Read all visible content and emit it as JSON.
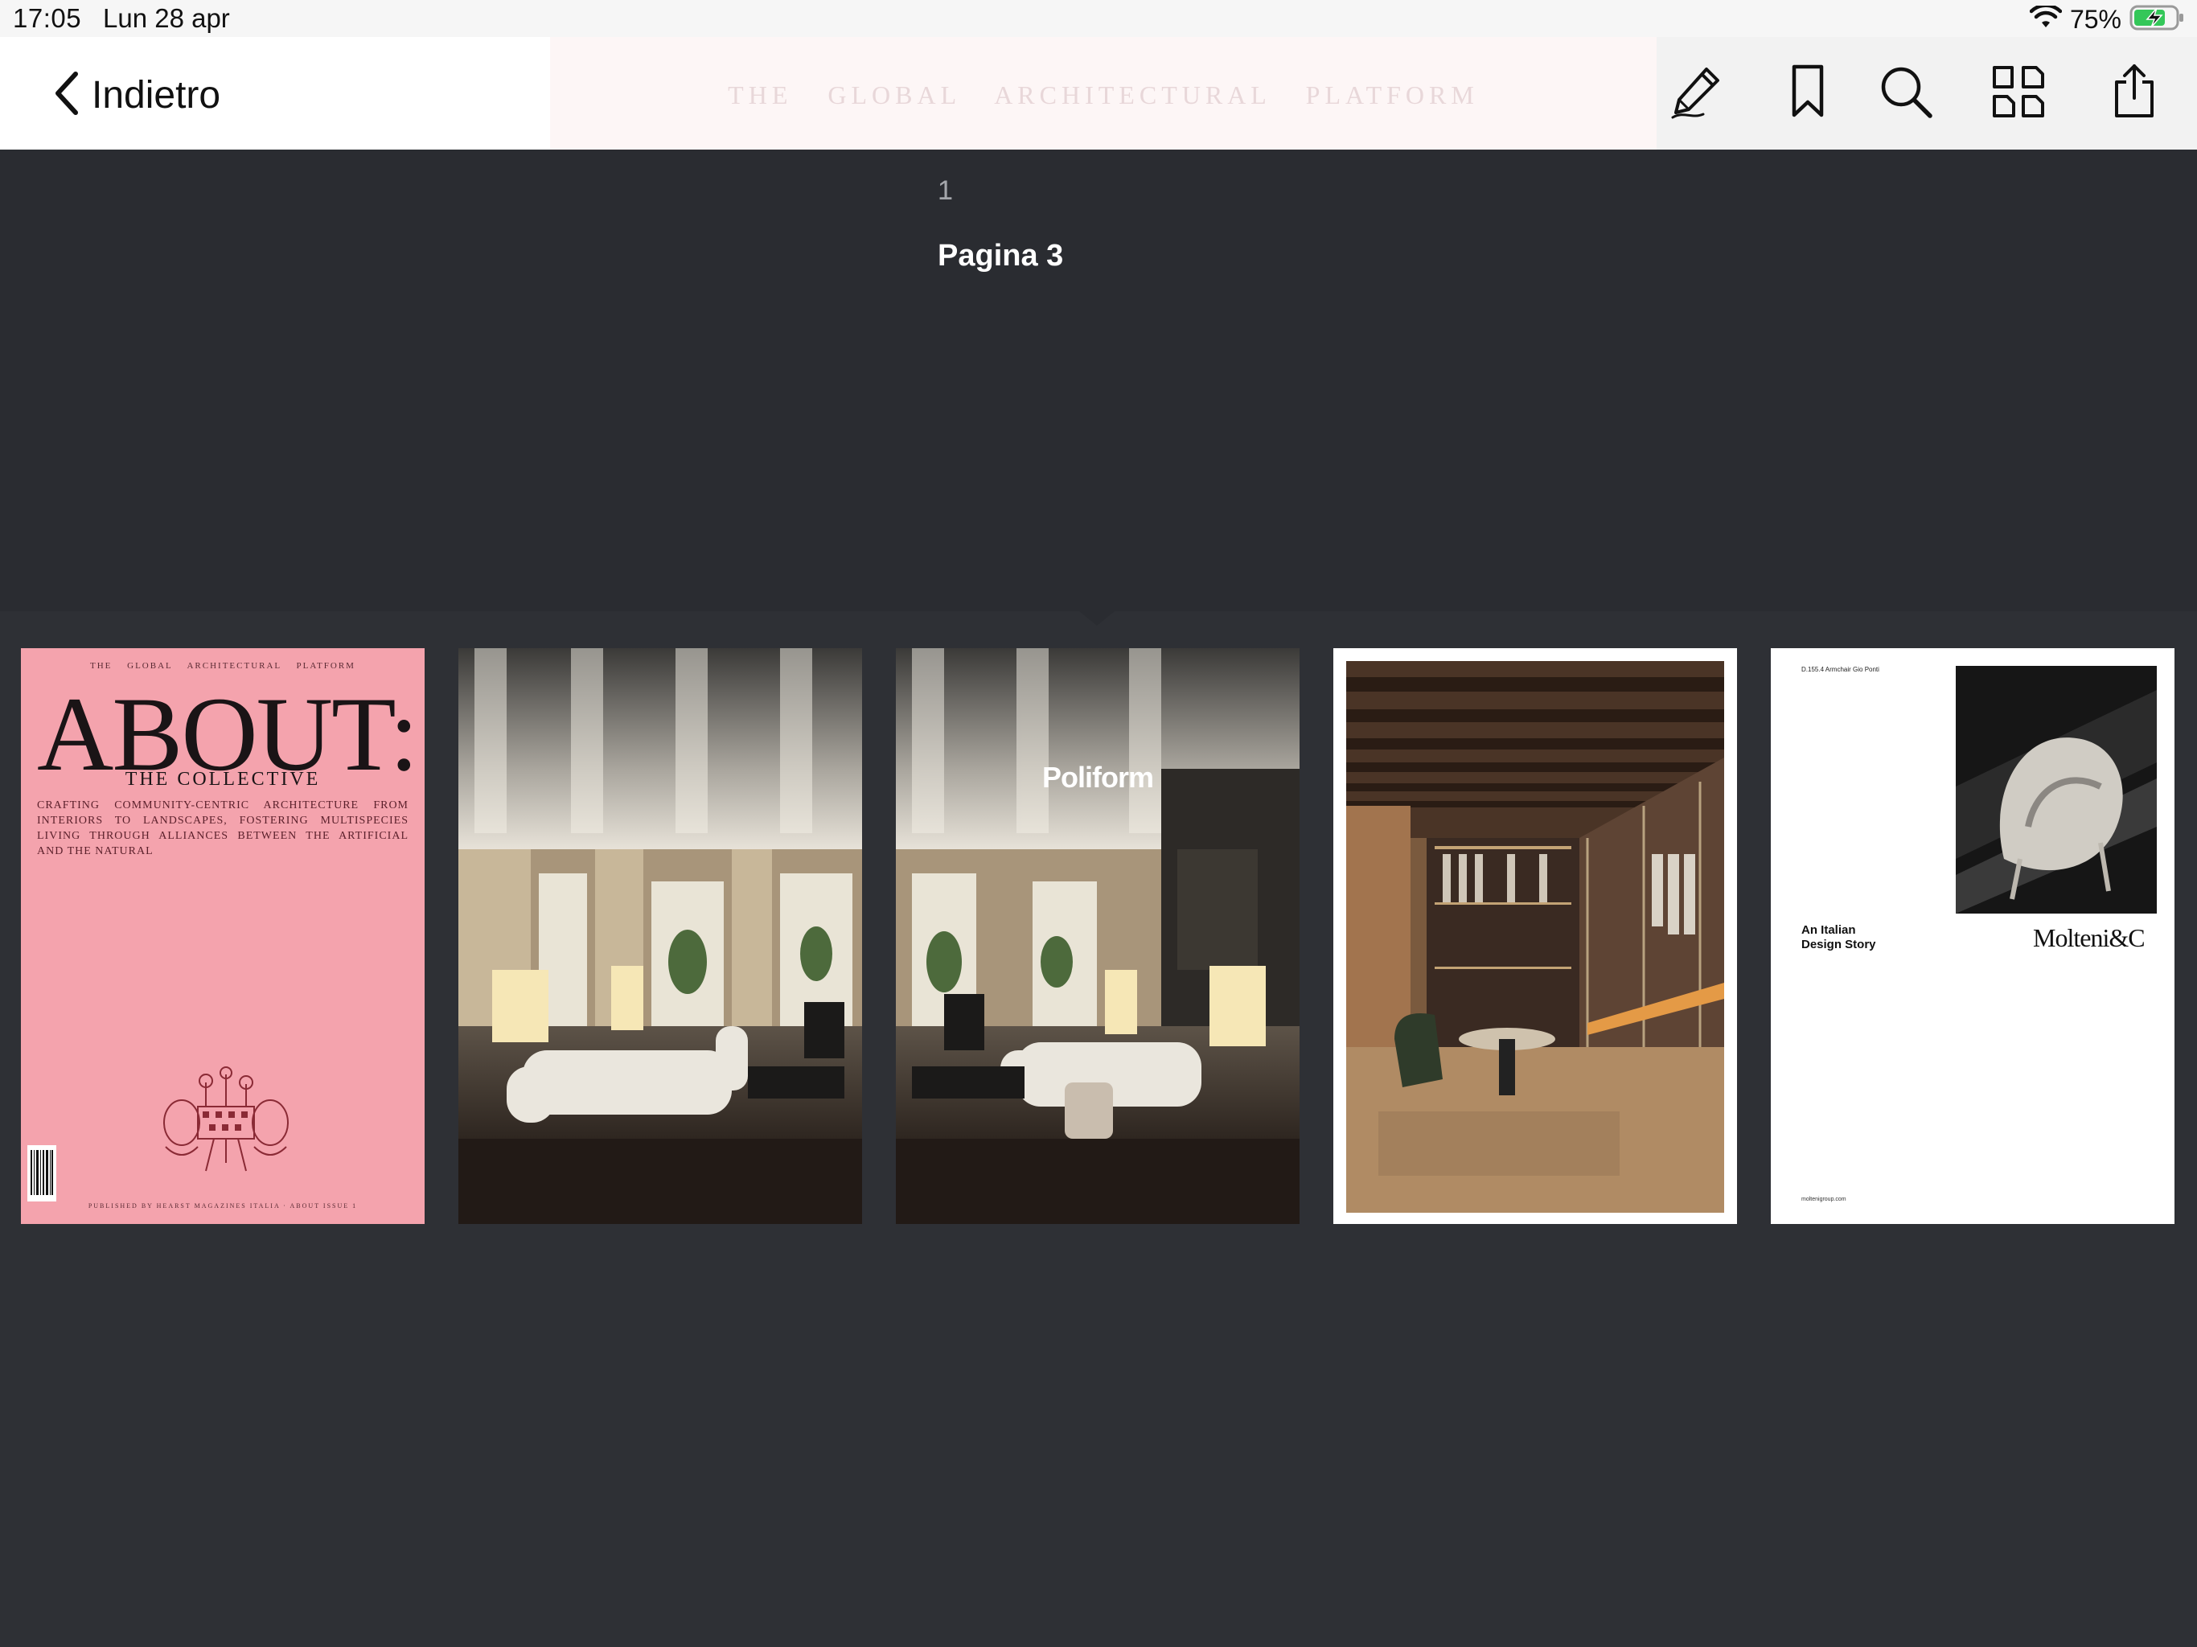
{
  "status_bar": {
    "time": "17:05",
    "date": "Lun 28 apr",
    "battery_percent": "75%",
    "battery_level": 0.75,
    "battery_color": "#34c759",
    "icons": [
      "wifi-icon",
      "battery-charging-icon"
    ]
  },
  "toolbar": {
    "back_label": "Indietro",
    "ghost_title": "THE GLOBAL ARCHITECTURAL PLATFORM",
    "tools": [
      "markup-pencil-icon",
      "bookmark-icon",
      "search-icon",
      "thumbnails-grid-icon",
      "share-icon"
    ]
  },
  "page_info": {
    "number": "1",
    "label": "Pagina 3"
  },
  "thumbnails": [
    {
      "kind": "cover",
      "top_line": "THE GLOBAL ARCHITECTURAL PLATFORM",
      "masthead": "ABOUT:",
      "subtitle": "THE COLLECTIVE",
      "body": "Crafting community-centric architecture from interiors to landscapes, fostering multispecies living through alliances between the artificial and the natural",
      "footer": "PUBLISHED BY HEARST MAGAZINES ITALIA · ABOUT ISSUE 1",
      "background": "#f4a3ad"
    },
    {
      "kind": "photo-room-left"
    },
    {
      "kind": "photo-room-right",
      "brand": "Poliform"
    },
    {
      "kind": "photo-wardrobe"
    },
    {
      "kind": "ad",
      "small_text": "D.155.4 Armchair Gio Ponti",
      "tagline_line1": "An Italian",
      "tagline_line2": "Design Story",
      "brand": "Molteni&C",
      "url": "moltenigroup.com"
    }
  ],
  "colors": {
    "background": "#2a2c31",
    "strip": "#2e3035",
    "toolbar": "#ffffff",
    "page_label": "#ffffff"
  }
}
